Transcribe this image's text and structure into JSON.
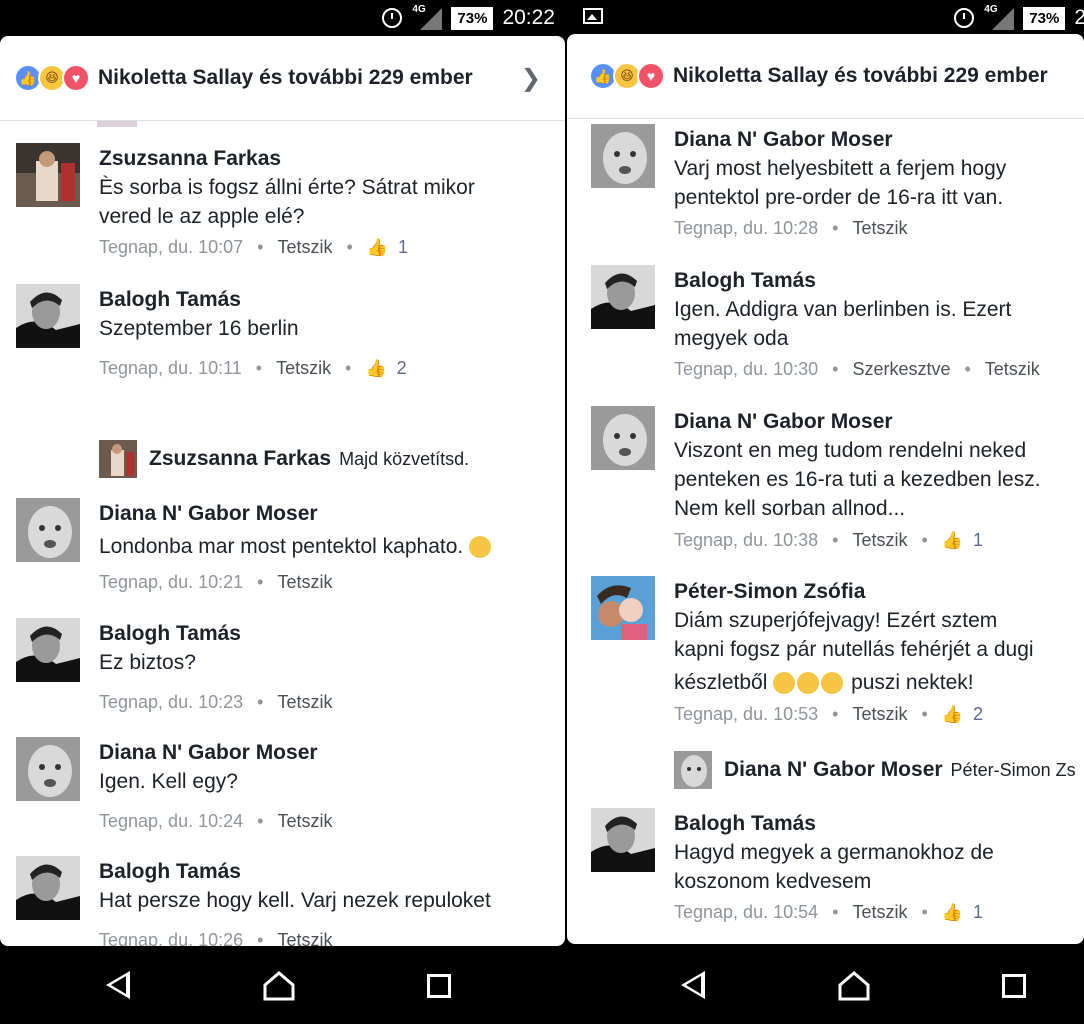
{
  "left": {
    "status": {
      "battery": "73%",
      "network": "4G",
      "time": "20:22"
    },
    "header": {
      "title": "Nikoletta Sallay és további 229 ember"
    },
    "comments": [
      {
        "name": "Zsuzsanna Farkas",
        "lines": [
          "Ès sorba is fogsz állni érte? Sátrat mikor",
          "vered le az apple elé?"
        ],
        "time": "Tegnap, du. 10:07",
        "like": "Tetszik",
        "likes": "1"
      },
      {
        "name": "Balogh Tamás",
        "lines": [
          "Szeptember 16 berlin"
        ],
        "time": "Tegnap, du. 10:11",
        "like": "Tetszik",
        "likes": "2"
      },
      {
        "reply": {
          "name": "Zsuzsanna Farkas",
          "text": "Majd közvetítsd."
        }
      },
      {
        "name": "Diana N' Gabor Moser",
        "lines": [
          "Londonba mar most pentektol kaphato."
        ],
        "time": "Tegnap, du. 10:21",
        "like": "Tetszik"
      },
      {
        "name": "Balogh Tamás",
        "lines": [
          "Ez biztos?"
        ],
        "time": "Tegnap, du. 10:23",
        "like": "Tetszik"
      },
      {
        "name": "Diana N' Gabor Moser",
        "lines": [
          "Igen. Kell egy?"
        ],
        "time": "Tegnap, du. 10:24",
        "like": "Tetszik"
      },
      {
        "name": "Balogh Tamás",
        "lines": [
          "Hat persze hogy kell. Varj nezek repuloket"
        ],
        "time": "Tegnap, du. 10:26",
        "like": "Tetszik"
      }
    ]
  },
  "right": {
    "status": {
      "battery": "73%",
      "network": "4G",
      "time": "2"
    },
    "header": {
      "title": "Nikoletta Sallay és további 229 ember"
    },
    "comments": [
      {
        "name": "Diana N' Gabor Moser",
        "lines": [
          "Varj most helyesbitett a ferjem hogy",
          "pentektol pre-order de 16-ra itt van."
        ],
        "time": "Tegnap, du. 10:28",
        "like": "Tetszik"
      },
      {
        "name": "Balogh Tamás",
        "lines": [
          "Igen. Addigra van berlinben is. Ezert",
          "megyek oda"
        ],
        "time": "Tegnap, du. 10:30",
        "edited": "Szerkesztve",
        "like": "Tetszik"
      },
      {
        "name": "Diana N' Gabor Moser",
        "lines": [
          "Viszont en meg tudom rendelni neked",
          "penteken es 16-ra tuti a kezedben lesz.",
          "Nem kell sorban allnod..."
        ],
        "time": "Tegnap, du. 10:38",
        "like": "Tetszik",
        "likes": "1"
      },
      {
        "name": "Péter-Simon Zsófia",
        "lines": [
          "Diám szuperjófejvagy! Ezért sztem",
          "kapni fogsz pár nutellás fehérjét a dugi",
          "készletből",
          "puszi nektek!"
        ],
        "time": "Tegnap, du. 10:53",
        "like": "Tetszik",
        "likes": "2"
      },
      {
        "reply": {
          "name": "Diana N' Gabor Moser",
          "text": "Péter-Simon Zs"
        }
      },
      {
        "name": "Balogh Tamás",
        "lines": [
          "Hagyd megyek a germanokhoz de",
          "koszonom kedvesem"
        ],
        "time": "Tegnap, du. 10:54",
        "like": "Tetszik",
        "likes": "1"
      }
    ]
  }
}
